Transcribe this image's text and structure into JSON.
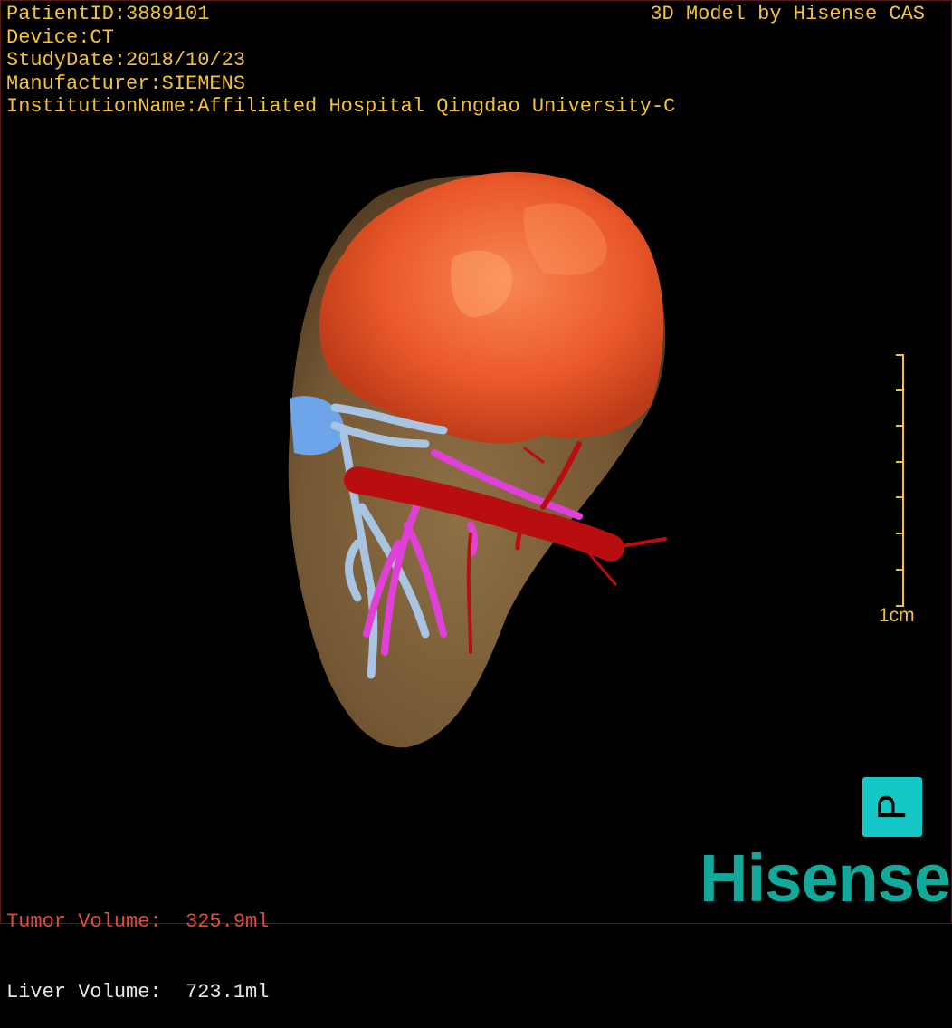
{
  "header": {
    "patient_id": "PatientID:3889101",
    "device": "Device:CT",
    "study_date": "StudyDate:2018/10/23",
    "manufacturer": "Manufacturer:SIEMENS",
    "institution": "InstitutionName:Affiliated Hospital Qingdao University-C",
    "credit": "3D Model by Hisense CAS"
  },
  "scale": {
    "label": "1cm"
  },
  "orientation": {
    "label": "P",
    "color": "#14c8c8"
  },
  "volumes": {
    "tumor": "Tumor Volume:  325.9ml",
    "liver": "Liver Volume:  723.1ml"
  },
  "brand": {
    "logo": "Hisense",
    "color": "#12a89a"
  },
  "colors": {
    "text": "#f2c23a",
    "tumor": "#ff5a2a",
    "liver": "#8a6a3e",
    "artery": "#b80e10",
    "portal_vein": "#e040d8",
    "hepatic_vein": "#a8c4e0"
  }
}
